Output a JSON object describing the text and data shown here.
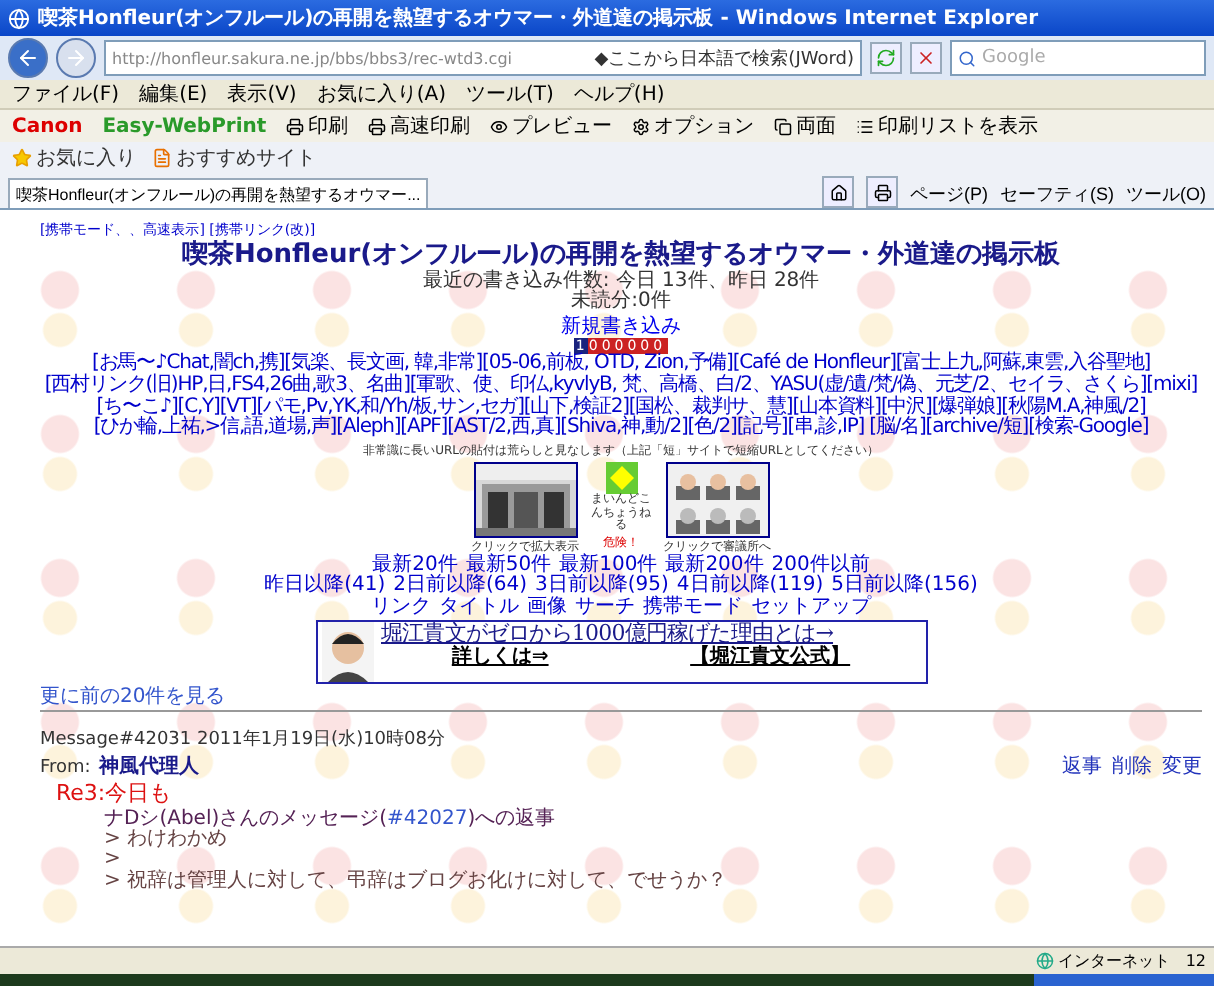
{
  "window": {
    "title": "喫茶Honfleur(オンフルール)の再開を熱望するオウマー・外道達の掲示板 - Windows Internet Explorer"
  },
  "address_bar": {
    "url": "http://honfleur.sakura.ne.jp/bbs/bbs3/rec-wtd3.cgi",
    "search_hint": "◆ここから日本語で検索(JWord)",
    "search_placeholder": "Google"
  },
  "menu": [
    "ファイル(F)",
    "編集(E)",
    "表示(V)",
    "お気に入り(A)",
    "ツール(T)",
    "ヘルプ(H)"
  ],
  "print_toolbar": {
    "brand": "Canon",
    "product": "Easy-WebPrint",
    "items": [
      "印刷",
      "高速印刷",
      "プレビュー",
      "オプション",
      "両面",
      "印刷リストを表示"
    ]
  },
  "favorites_bar": {
    "label": "お気に入り",
    "site": "おすすめサイト"
  },
  "tab": {
    "title": "喫茶Honfleur(オンフルール)の再開を熱望するオウマー..."
  },
  "command_bar": [
    "ページ(P)",
    "セーフティ(S)",
    "ツール(O)"
  ],
  "page": {
    "mode_links": "[携帯モード、、高速表示] [携帯リンク(改)]",
    "heading": "喫茶Honfleur(オンフルール)の再開を熱望するオウマー・外道達の掲示板",
    "stats": [
      "最近の書き込み件数: 今日 13件、昨日 28件",
      "未読分:0件"
    ],
    "new_post": "新規書き込み",
    "counter": "1000000",
    "link_lines": [
      "[お馬〜♪Chat,闇ch,携][気楽、長文画, 韓,非常][05-06,前板, OTD, Zion,予備][Café de Honfleur][富士上九,阿蘇,東雲,入谷聖地]",
      "[西村リンク(旧)HP,日,FS4,26曲,歌3、名曲][軍歌、使、印仏,kyvlyB, 梵、高橋、白/2、YASU(虚/遺/梵/偽、元芝/2、セイラ、さくら][mixi]",
      "[ち〜こ♪][C,Y][VT][パモ,Pv,YK,和/Yh/板,サン,セガ][山下,検証2][国松、裁判サ、慧][山本資料][中沢][爆弾娘][秋陽M.A,神風/2]",
      "[ひか輪,上祐,>信,語,道場,声][Aleph][APF][AST/2,西,真][Shiva,神,動/2][色/2][記号][串,診,IP] [脳/名][archive/短][検索-Google]"
    ],
    "notice": "非常識に長いURLの貼付は荒らしと見なします（上記「短」サイトで短縮URLとしてください）",
    "gallery": [
      {
        "kind": "picture",
        "caption": "クリックで拡大表示"
      },
      {
        "kind": "sign",
        "sign_text": "まいんどこんちょうねる",
        "warning": "危険！"
      },
      {
        "kind": "picture",
        "caption": "クリックで審議所へ"
      }
    ],
    "latest_rows": [
      [
        "最新20件",
        "最新50件",
        "最新100件",
        "最新200件",
        "200件以前"
      ],
      [
        "昨日以降(41)",
        "2日前以降(64)",
        "3日前以降(95)",
        "4日前以降(119)",
        "5日前以降(156)"
      ],
      [
        "リンク",
        "タイトル",
        "画像",
        "サーチ",
        "携帯モード",
        "セットアップ"
      ]
    ],
    "ad": {
      "headline": "堀江貴文がゼロから1000億円稼げた理由とは→",
      "more": "詳しくは⇒",
      "official": "【堀江貴文公式】"
    },
    "older_link": "更に前の20件を見る",
    "message": {
      "header": "Message#42031 2011年1月19日(水)10時08分",
      "from_label": "From:",
      "author": "神風代理人",
      "actions": [
        "返事",
        "削除",
        "変更"
      ],
      "subject": "Re3:今日も",
      "reply_to": {
        "before": "ナDシ(Abel)さんのメッセージ(",
        "link": "#42027",
        "after": ")への返事"
      },
      "quotes": [
        "> わけわかめ",
        ">",
        "> 祝辞は管理人に対して、弔辞はブログお化けに対して、でせうか？"
      ]
    }
  },
  "status_bar": {
    "zone": "インターネット",
    "zoom": "12"
  }
}
